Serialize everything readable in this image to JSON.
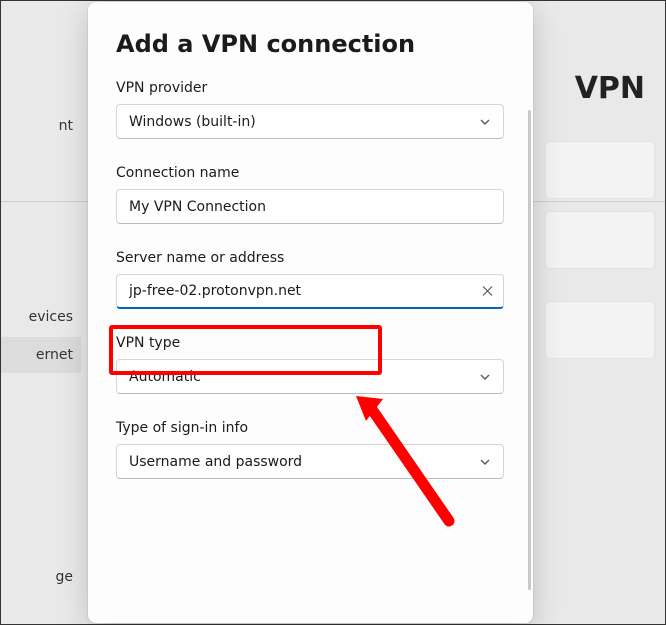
{
  "background": {
    "page_title_right": "VPN",
    "sidebar_items": [
      "nt",
      "evices",
      "ernet",
      "ge"
    ]
  },
  "modal": {
    "title": "Add a VPN connection",
    "fields": {
      "provider": {
        "label": "VPN provider",
        "value": "Windows (built-in)"
      },
      "conn_name": {
        "label": "Connection name",
        "value": "My VPN Connection"
      },
      "server": {
        "label": "Server name or address",
        "value": "jp-free-02.protonvpn.net"
      },
      "vpn_type": {
        "label": "VPN type",
        "value": "Automatic"
      },
      "signin": {
        "label": "Type of sign-in info",
        "value": "Username and password"
      }
    }
  }
}
